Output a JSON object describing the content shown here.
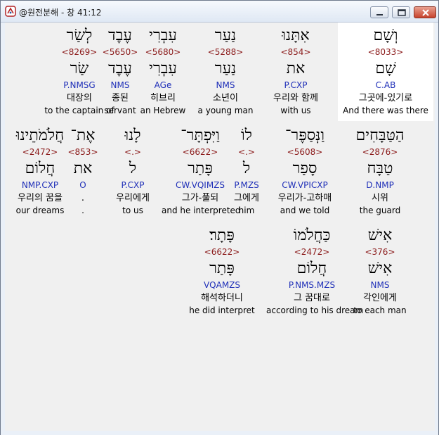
{
  "window": {
    "title": "@원전분해 - 창 41:12"
  },
  "icons": {
    "app": "app-logo-icon",
    "minimize": "minimize-icon",
    "maximize": "maximize-icon",
    "close": "close-icon"
  },
  "colors": {
    "strong": "#8b1a1a",
    "morph": "#1f2fb8",
    "highlight": "#ffffff"
  },
  "rows": [
    [
      {
        "heb": "וְשָׁם",
        "strong": "<8033>",
        "lemma": "שָׁם",
        "morph": "C.AB",
        "kor": "그곳에-있기로",
        "eng": "And there was there",
        "highlighted": true
      },
      {
        "heb": "אִתָּנוּ",
        "strong": "<854>",
        "lemma": "את",
        "morph": "P.CXP",
        "kor": "우리와 함께",
        "eng": "with us",
        "highlighted": false
      },
      {
        "heb": "נַעַר",
        "strong": "<5288>",
        "lemma": "נַעַר",
        "morph": "NMS",
        "kor": "소년이",
        "eng": "a young man",
        "highlighted": false
      },
      {
        "heb": "עִבְרִי",
        "strong": "<5680>",
        "lemma": "עִבְרִי",
        "morph": "AGe",
        "kor": "히브리",
        "eng": "an Hebrew",
        "highlighted": false
      },
      {
        "heb": "עֶבֶד",
        "strong": "<5650>",
        "lemma": "עֶבֶד",
        "morph": "NMS",
        "kor": "종된",
        "eng": "servant",
        "highlighted": false
      },
      {
        "heb": "לְשַׂר",
        "strong": "<8269>",
        "lemma": "שַׂר",
        "morph": "P.NMSG",
        "kor": "대장의",
        "eng": "to the captain of",
        "highlighted": false
      }
    ],
    [
      {
        "heb": "הַטַּבָּחִים",
        "strong": "<2876>",
        "lemma": "טַבָּח",
        "morph": "D.NMP",
        "kor": "시위",
        "eng": "the guard",
        "highlighted": false
      },
      {
        "heb": "וַנְּסַפֶּר־",
        "strong": "<5608>",
        "lemma": "סָפַר",
        "morph": "CW.VPICXP",
        "kor": "우리가-고하매",
        "eng": "and we told",
        "highlighted": false
      },
      {
        "heb": "לוֹ",
        "strong": "<.>",
        "lemma": "ל",
        "morph": "P.MZS",
        "kor": "그에게",
        "eng": "him",
        "highlighted": false
      },
      {
        "heb": "וַיִּפְתָּר־",
        "strong": "<6622>",
        "lemma": "פָּתַר",
        "morph": "CW.VQIMZS",
        "kor": "그가-풀되",
        "eng": "and he interpreted",
        "highlighted": false
      },
      {
        "heb": "לָנוּ",
        "strong": "<.>",
        "lemma": "ל",
        "morph": "P.CXP",
        "kor": "우리에게",
        "eng": "to us",
        "highlighted": false
      },
      {
        "heb": "אֶת־",
        "strong": "<853>",
        "lemma": "את",
        "morph": "O",
        "kor": ".",
        "eng": ".",
        "highlighted": false
      },
      {
        "heb": "חֲלֹמֹתֵינוּ",
        "strong": "<2472>",
        "lemma": "חֲלוֹם",
        "morph": "NMP.CXP",
        "kor": "우리의 꿈을",
        "eng": "our dreams",
        "highlighted": false
      }
    ],
    [
      {
        "heb": "אִישׁ",
        "strong": "<376>",
        "lemma": "אִישׁ",
        "morph": "NMS",
        "kor": "각인에게",
        "eng": "to each man",
        "highlighted": false
      },
      {
        "heb": "כַּחֲלֹמוֹ",
        "strong": "<2472>",
        "lemma": "חֲלוֹם",
        "morph": "P.NMS.MZS",
        "kor": "그 꿈대로",
        "eng": "according to his dream",
        "highlighted": false
      },
      {
        "heb": "פָּתָר׃",
        "strong": "<6622>",
        "lemma": "פָּתַר",
        "morph": "VQAMZS",
        "kor": "해석하더니",
        "eng": "he did interpret",
        "highlighted": false
      }
    ]
  ]
}
